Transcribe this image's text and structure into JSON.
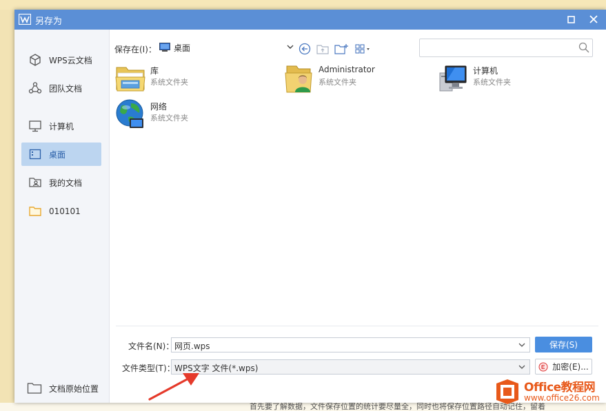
{
  "background": {
    "bottom_text": "首先要了解数据，文件保存位置的统计要尽量全，同时也将保存位置路径自动记住，留着"
  },
  "dialog": {
    "title": "另存为",
    "accent_color": "#5b8fd6",
    "buttons": {
      "maximize": "maximize-icon",
      "close": "close-icon"
    }
  },
  "sidebar": {
    "items": [
      {
        "label": "WPS云文档",
        "icon": "cloud-cube-icon"
      },
      {
        "label": "团队文档",
        "icon": "team-icon"
      },
      {
        "label": "计算机",
        "icon": "monitor-icon"
      },
      {
        "label": "桌面",
        "icon": "desktop-icon",
        "active": true
      },
      {
        "label": "我的文档",
        "icon": "my-docs-icon"
      },
      {
        "label": "010101",
        "icon": "folder-icon"
      }
    ],
    "bottom_label": "文档原始位置"
  },
  "toolbar": {
    "save_in_label": "保存在(I)：",
    "location": "桌面",
    "back": "back-icon",
    "up": "up-folder-icon",
    "new_folder": "new-folder-icon",
    "view": "view-grid-icon"
  },
  "search": {
    "placeholder": ""
  },
  "files": [
    {
      "name": "库",
      "type": "系统文件夹",
      "icon": "library-folder-icon"
    },
    {
      "name": "Administrator",
      "type": "系统文件夹",
      "icon": "user-folder-icon"
    },
    {
      "name": "计算机",
      "type": "系统文件夹",
      "icon": "computer-icon"
    },
    {
      "name": "网络",
      "type": "系统文件夹",
      "icon": "network-globe-icon"
    }
  ],
  "form": {
    "filename_label": "文件名(N)：",
    "filename_value": "网页.wps",
    "filetype_label": "文件类型(T)：",
    "filetype_value": "WPS文字 文件(*.wps)",
    "save_button": "保存(S)",
    "encrypt_button": "加密(E)..."
  },
  "watermark": {
    "name": "Office教程网",
    "url": "www.office26.com"
  }
}
